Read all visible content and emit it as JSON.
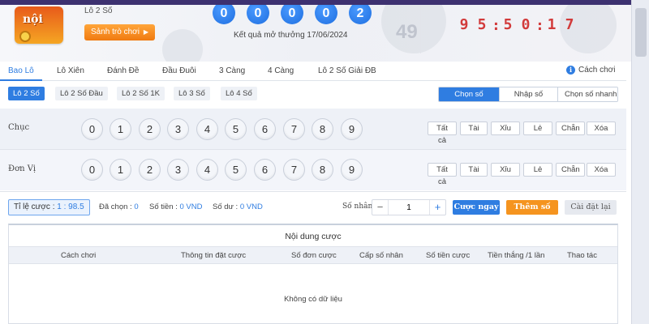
{
  "header": {
    "logo_text": "nội",
    "game_name": "Lô 2 Số",
    "lobby_button": "Sảnh trò chơi",
    "result_balls": [
      "0",
      "0",
      "0",
      "0",
      "2"
    ],
    "result_date": "Kết quả mở thưởng 17/06/2024",
    "countdown": [
      "9",
      "5",
      ":",
      "5",
      "0",
      ":",
      "1",
      "7"
    ]
  },
  "main_tabs": [
    "Bao Lô",
    "Lô Xiên",
    "Đánh Đề",
    "Đầu Đuôi",
    "3 Càng",
    "4 Càng",
    "Lô 2 Số Giải ĐB"
  ],
  "help": {
    "icon": "info-icon",
    "icon_glyph": "i",
    "label": "Cách chơi"
  },
  "sub_tabs": [
    "Lô 2 Số",
    "Lô 2 Số Đầu",
    "Lô 2 Số 1K",
    "Lô 3 Số",
    "Lô 4 Số"
  ],
  "mode_buttons": [
    "Chọn số",
    "Nhập số",
    "Chọn số nhanh"
  ],
  "rows": [
    {
      "label": "Chục",
      "numbers": [
        "0",
        "1",
        "2",
        "3",
        "4",
        "5",
        "6",
        "7",
        "8",
        "9"
      ]
    },
    {
      "label": "Đơn Vị",
      "numbers": [
        "0",
        "1",
        "2",
        "3",
        "4",
        "5",
        "6",
        "7",
        "8",
        "9"
      ]
    }
  ],
  "quick_select": [
    "Tất cả",
    "Tài",
    "Xỉu",
    "Lẻ",
    "Chẵn",
    "Xóa"
  ],
  "bet_bar": {
    "rate_label": "Tỉ lệ cược :",
    "rate_value": "1 : 98.5",
    "selected_label": "Đã chọn :",
    "selected_value": "0",
    "amount_label": "Số tiền :",
    "amount_value": "0 VND",
    "balance_label": "Số dư :",
    "balance_value": "0 VND",
    "multiplier_label": "Số nhân :",
    "minus": "−",
    "plus": "+",
    "multiplier_value": "1",
    "bet_now": "Cược ngay",
    "add_number": "Thêm số",
    "reset": "Cài đặt lại"
  },
  "bet_table": {
    "title": "Nội dung cược",
    "columns": [
      "Cách chơi",
      "Thông tin đặt cược",
      "Số đơn cược",
      "Cấp số nhân",
      "Số tiền cược",
      "Tiền thắng /1 lần",
      "Thao tác"
    ],
    "empty": "Không có dữ liệu"
  },
  "colors": {
    "accent": "#2f7de1",
    "orange": "#f5941f",
    "countdown": "#d23b3b"
  }
}
